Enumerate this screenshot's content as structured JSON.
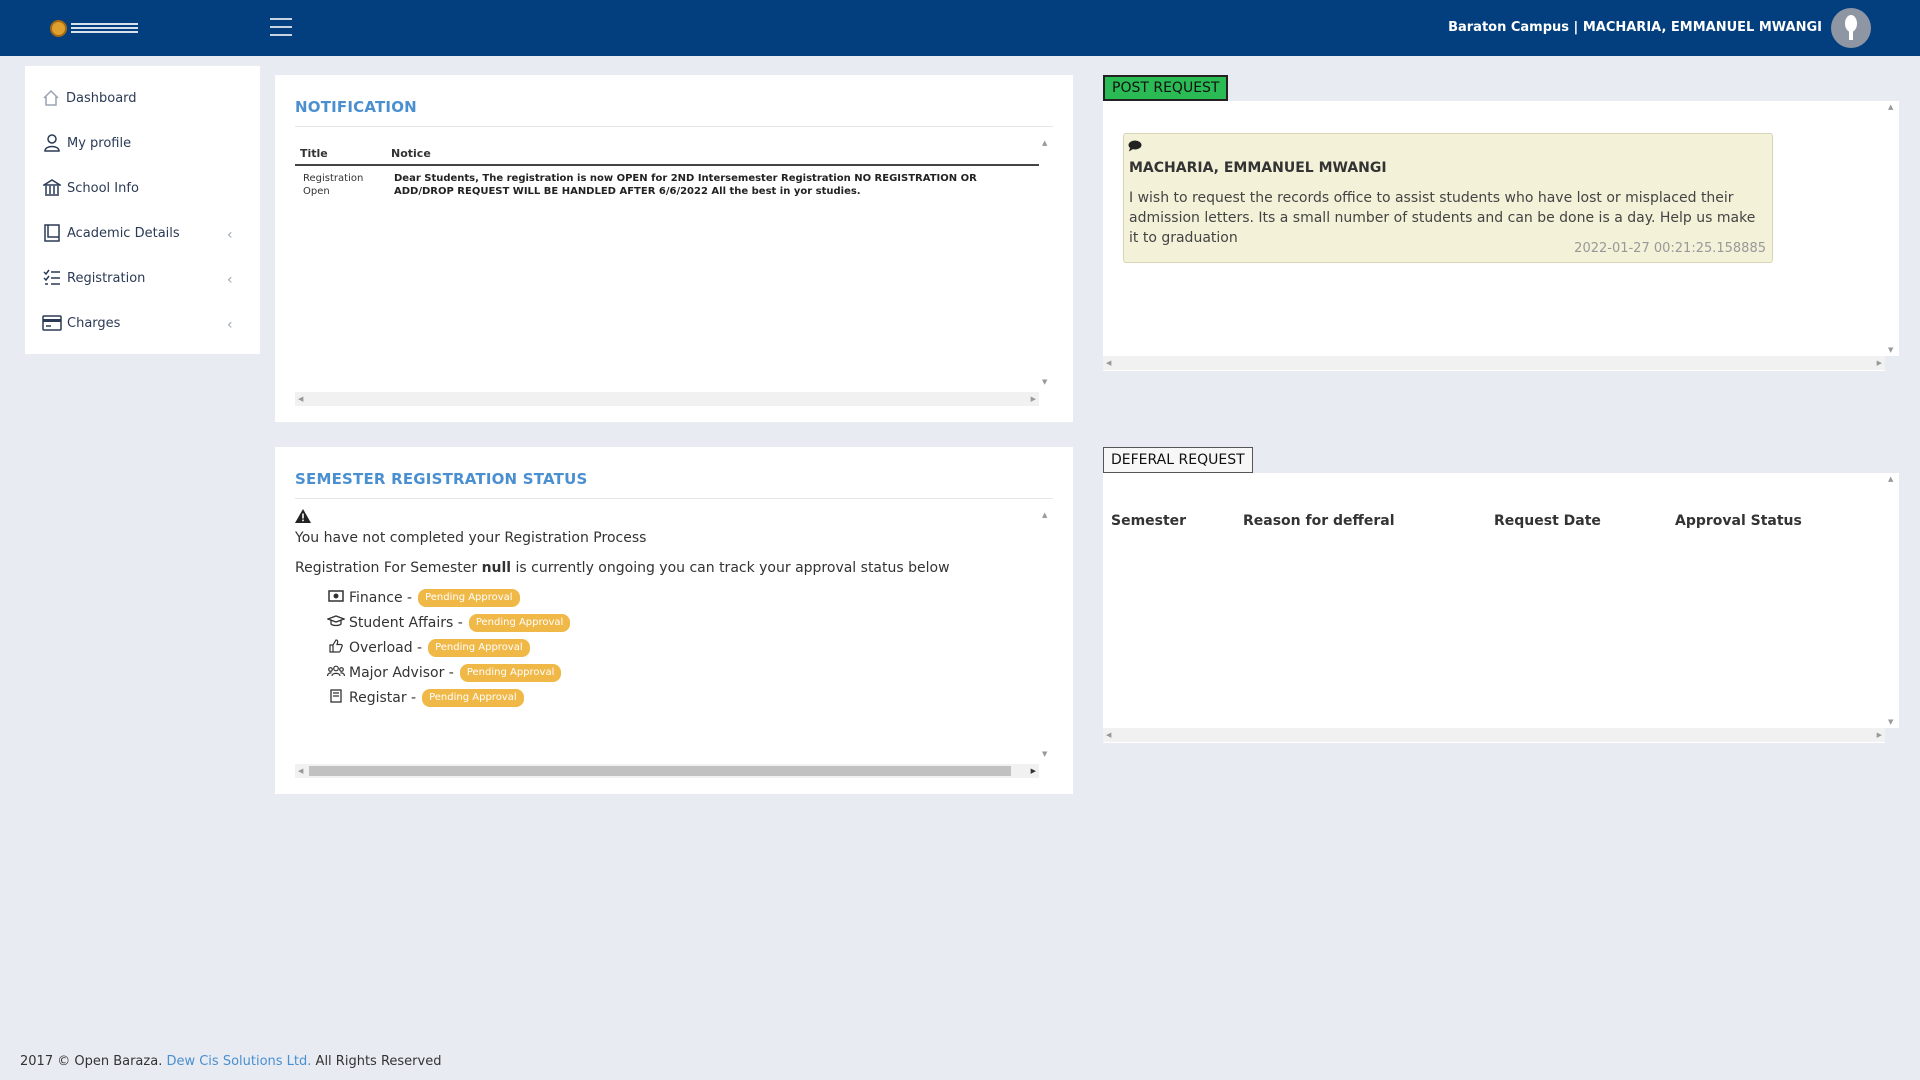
{
  "header": {
    "user_info": "Baraton Campus | MACHARIA, EMMANUEL MWANGI"
  },
  "sidebar": {
    "items": [
      {
        "label": "Dashboard",
        "icon": "home-icon"
      },
      {
        "label": "My profile",
        "icon": "user-icon"
      },
      {
        "label": "School Info",
        "icon": "bank-icon"
      },
      {
        "label": "Academic Details",
        "icon": "book-icon"
      },
      {
        "label": "Registration",
        "icon": "checklist-icon"
      },
      {
        "label": "Charges",
        "icon": "credit-card-icon"
      }
    ]
  },
  "notification": {
    "title": "NOTIFICATION",
    "columns": [
      "Title",
      "Notice"
    ],
    "rows": [
      {
        "title": "Registration Open",
        "notice": "Dear Students, The registration is now OPEN for 2ND Intersemester Registration NO REGISTRATION OR ADD/DROP REQUEST WILL BE HANDLED AFTER 6/6/2022 All the best in yor studies."
      }
    ]
  },
  "semester_status": {
    "title": "SEMESTER REGISTRATION STATUS",
    "incomplete_msg": "You have not completed your Registration Process",
    "ongoing_prefix": "Registration For Semester ",
    "semester": "null",
    "ongoing_suffix": " is currently ongoing you can track your approval status below",
    "approvals": [
      {
        "label": "Finance -",
        "status": "Pending Approval",
        "icon": "money-icon"
      },
      {
        "label": "Student Affairs -",
        "status": "Pending Approval",
        "icon": "graduation-cap-icon"
      },
      {
        "label": "Overload -",
        "status": "Pending Approval",
        "icon": "thumbs-up-icon"
      },
      {
        "label": "Major Advisor -",
        "status": "Pending Approval",
        "icon": "users-icon"
      },
      {
        "label": "Registar -",
        "status": "Pending Approval",
        "icon": "book-icon"
      }
    ]
  },
  "post_request": {
    "button_label": "POST REQUEST",
    "message": {
      "author": "MACHARIA, EMMANUEL MWANGI",
      "text": "I wish to request the records office to assist students who have lost or misplaced their admission letters. Its a small number of students and can be done is a day. Help us make it to graduation",
      "timestamp": "2022-01-27 00:21:25.158885"
    }
  },
  "deferral_request": {
    "button_label": "DEFERAL REQUEST",
    "columns": [
      "Semester",
      "Reason for defferal",
      "Request Date",
      "Approval Status"
    ]
  },
  "footer": {
    "prefix": "2017 © Open Baraza. ",
    "link": "Dew Cis Solutions Ltd.",
    "suffix": " All Rights Reserved"
  },
  "colors": {
    "header_bg": "#033f7e",
    "accent_title": "#4a8fd0",
    "pending_badge": "#f0b847",
    "post_button": "#2bbb55",
    "message_bg": "#f3f1d8"
  }
}
